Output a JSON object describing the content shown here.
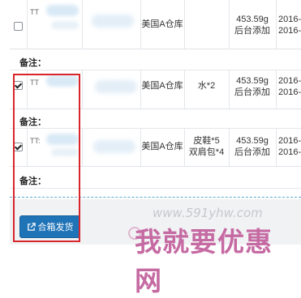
{
  "orders": [
    {
      "checked": false,
      "id_text": "TT",
      "warehouse": "美国A仓库",
      "items": [],
      "weight": "453.59g",
      "added_by": "后台添加",
      "dates": [
        "2016-",
        "2016-"
      ],
      "note_label": "备注："
    },
    {
      "checked": true,
      "id_text": "TT",
      "warehouse": "美国A仓库",
      "items": [
        "水*2"
      ],
      "weight": "453.59g",
      "added_by": "后台添加",
      "dates": [
        "2016-",
        "2016-"
      ],
      "note_label": "备注："
    },
    {
      "checked": true,
      "id_text": "TT:",
      "warehouse": "美国A仓库",
      "items": [
        "皮鞋*5",
        "双肩包*4"
      ],
      "weight": "453.59g",
      "added_by": "后台添加",
      "dates": [
        "2016-",
        "2016-"
      ],
      "note_label": "备注："
    }
  ],
  "actions": {
    "merge_ship_label": "合箱发货",
    "merge_ship_icon": "external-link-icon",
    "accent": "#1f73b7",
    "highlight_color": "#d8262c"
  },
  "watermark": {
    "url": "www.591yhw.com",
    "text": "我就要优惠网"
  }
}
